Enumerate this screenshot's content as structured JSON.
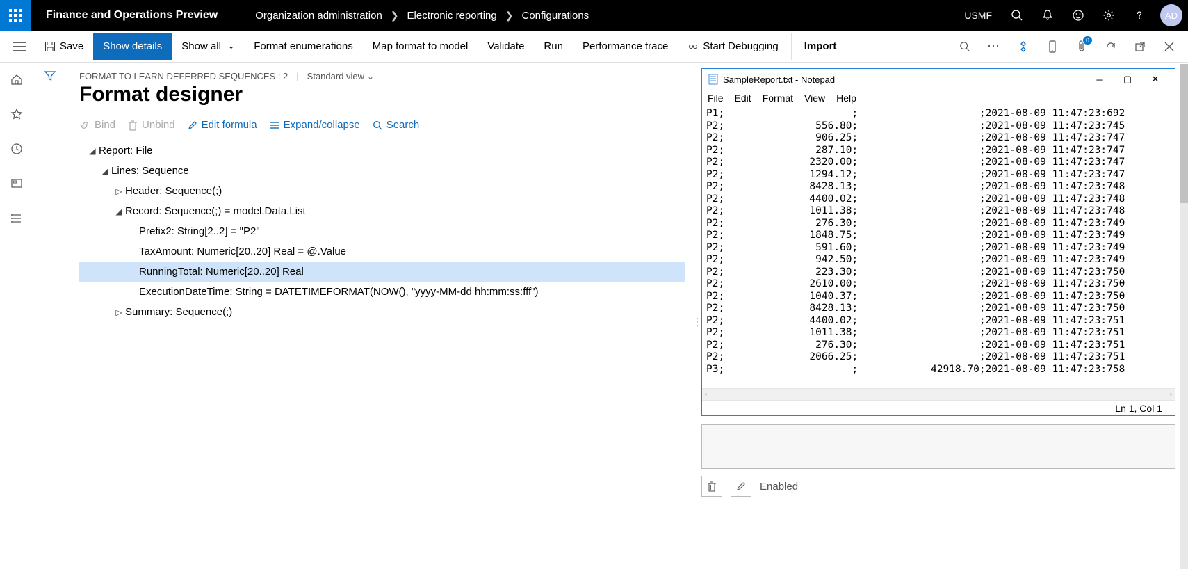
{
  "header": {
    "app_title": "Finance and Operations Preview",
    "breadcrumb": [
      "Organization administration",
      "Electronic reporting",
      "Configurations"
    ],
    "company": "USMF",
    "avatar": "AD"
  },
  "command_bar": {
    "save": "Save",
    "show_details": "Show details",
    "show_all": "Show all",
    "format_enum": "Format enumerations",
    "map_format": "Map format to model",
    "validate": "Validate",
    "run": "Run",
    "perf_trace": "Performance trace",
    "start_debug": "Start Debugging",
    "import": "Import",
    "badge": "0"
  },
  "page": {
    "path": "FORMAT TO LEARN DEFERRED SEQUENCES : 2",
    "std_view": "Standard view",
    "title": "Format designer"
  },
  "tree_toolbar": {
    "bind": "Bind",
    "unbind": "Unbind",
    "edit_formula": "Edit formula",
    "expand": "Expand/collapse",
    "search": "Search"
  },
  "tree": {
    "n0": "Report: File",
    "n1": "Lines: Sequence",
    "n2": "Header: Sequence(;)",
    "n3": "Record: Sequence(;) = model.Data.List",
    "n4": "Prefix2: String[2..2] = \"P2\"",
    "n5": "TaxAmount: Numeric[20..20] Real = @.Value",
    "n6": "RunningTotal: Numeric[20..20] Real",
    "n7": "ExecutionDateTime: String = DATETIMEFORMAT(NOW(), \"yyyy-MM-dd hh:mm:ss:fff\")",
    "n8": "Summary: Sequence(;)"
  },
  "notepad": {
    "title": "SampleReport.txt - Notepad",
    "menu": {
      "file": "File",
      "edit": "Edit",
      "format": "Format",
      "view": "View",
      "help": "Help"
    },
    "status": "Ln 1, Col 1",
    "rows": [
      [
        "P1;",
        "",
        ";",
        "",
        ";2021-08-09 11:47:23:692"
      ],
      [
        "P2;",
        "556.80;",
        "",
        "",
        ";2021-08-09 11:47:23:745"
      ],
      [
        "P2;",
        "906.25;",
        "",
        "",
        ";2021-08-09 11:47:23:747"
      ],
      [
        "P2;",
        "287.10;",
        "",
        "",
        ";2021-08-09 11:47:23:747"
      ],
      [
        "P2;",
        "2320.00;",
        "",
        "",
        ";2021-08-09 11:47:23:747"
      ],
      [
        "P2;",
        "1294.12;",
        "",
        "",
        ";2021-08-09 11:47:23:747"
      ],
      [
        "P2;",
        "8428.13;",
        "",
        "",
        ";2021-08-09 11:47:23:748"
      ],
      [
        "P2;",
        "4400.02;",
        "",
        "",
        ";2021-08-09 11:47:23:748"
      ],
      [
        "P2;",
        "1011.38;",
        "",
        "",
        ";2021-08-09 11:47:23:748"
      ],
      [
        "P2;",
        "276.30;",
        "",
        "",
        ";2021-08-09 11:47:23:749"
      ],
      [
        "P2;",
        "1848.75;",
        "",
        "",
        ";2021-08-09 11:47:23:749"
      ],
      [
        "P2;",
        "591.60;",
        "",
        "",
        ";2021-08-09 11:47:23:749"
      ],
      [
        "P2;",
        "942.50;",
        "",
        "",
        ";2021-08-09 11:47:23:749"
      ],
      [
        "P2;",
        "223.30;",
        "",
        "",
        ";2021-08-09 11:47:23:750"
      ],
      [
        "P2;",
        "2610.00;",
        "",
        "",
        ";2021-08-09 11:47:23:750"
      ],
      [
        "P2;",
        "1040.37;",
        "",
        "",
        ";2021-08-09 11:47:23:750"
      ],
      [
        "P2;",
        "8428.13;",
        "",
        "",
        ";2021-08-09 11:47:23:750"
      ],
      [
        "P2;",
        "4400.02;",
        "",
        "",
        ";2021-08-09 11:47:23:751"
      ],
      [
        "P2;",
        "1011.38;",
        "",
        "",
        ";2021-08-09 11:47:23:751"
      ],
      [
        "P2;",
        "276.30;",
        "",
        "",
        ";2021-08-09 11:47:23:751"
      ],
      [
        "P2;",
        "2066.25;",
        "",
        "",
        ";2021-08-09 11:47:23:751"
      ],
      [
        "P3;",
        "",
        ";",
        "42918.70",
        ";2021-08-09 11:47:23:758"
      ]
    ]
  },
  "below": {
    "enabled": "Enabled"
  }
}
